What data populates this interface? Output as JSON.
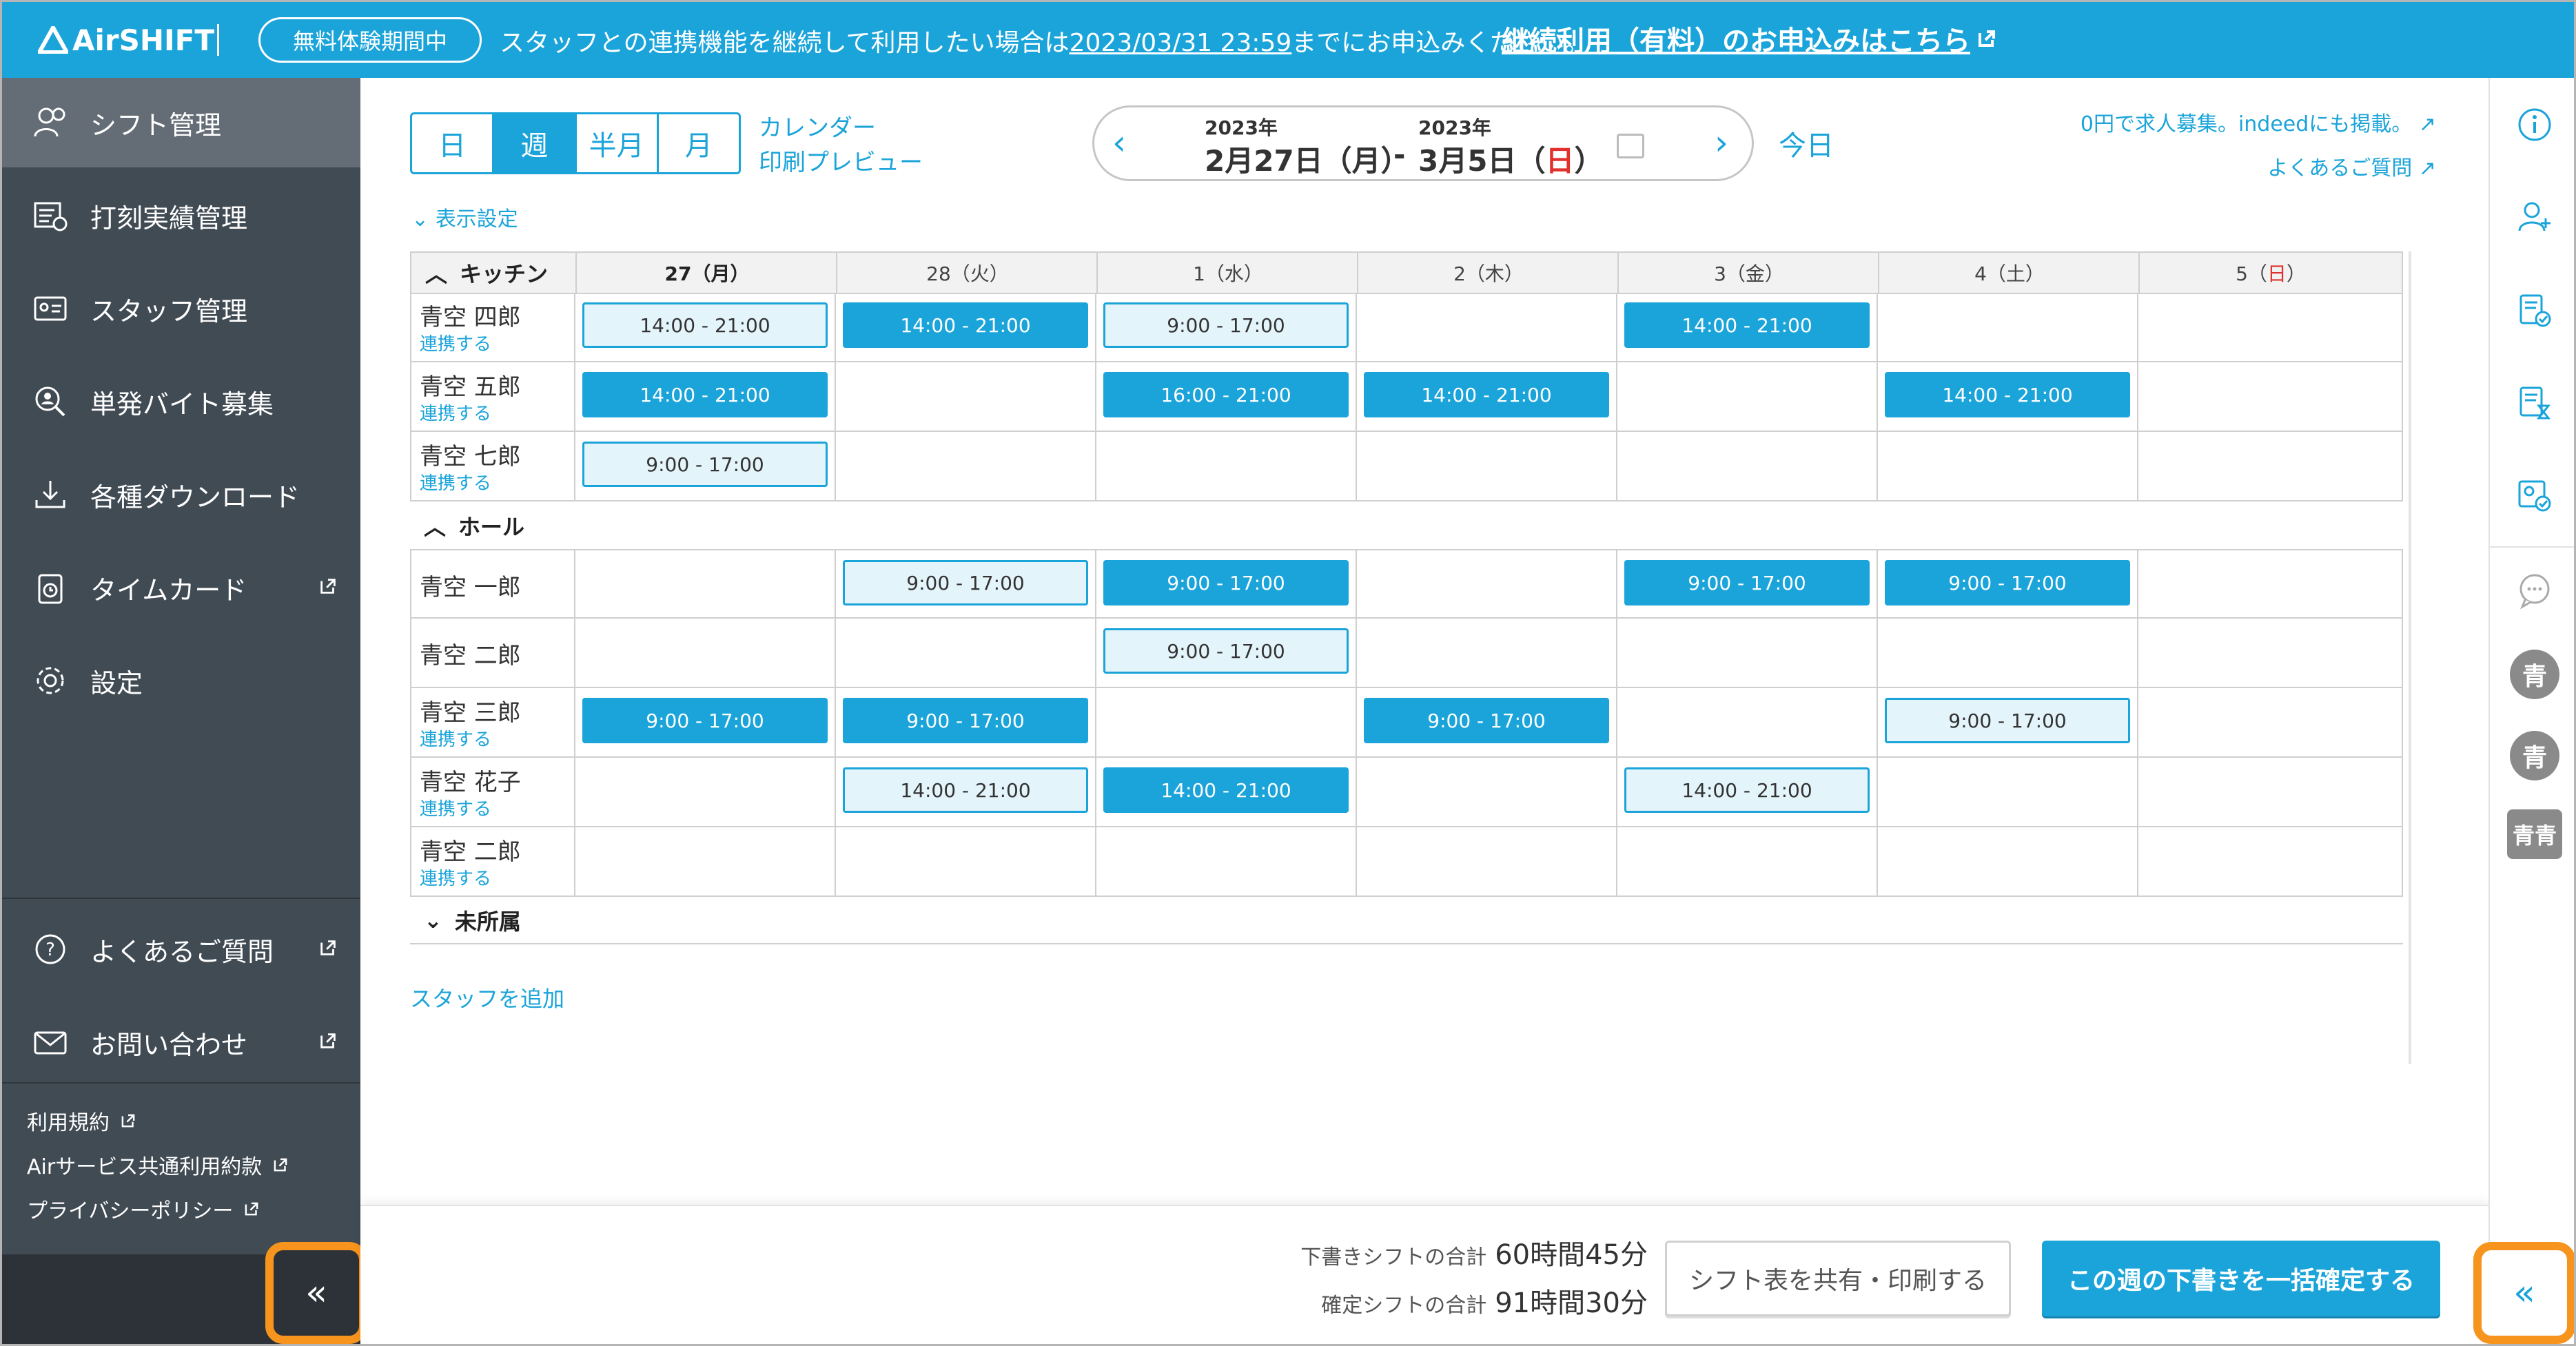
{
  "banner": {
    "logo": "AirSHIFT",
    "trial_badge": "無料体験期間中",
    "message_prefix": "スタッフとの連携機能を継続して利用したい場合は",
    "deadline": "2023/03/31 23:59",
    "message_suffix": "までにお申込みください。",
    "apply_link": "継続利用（有料）のお申込みはこちら"
  },
  "sidebar": {
    "items": [
      {
        "label": "シフト管理",
        "icon": "shift-icon"
      },
      {
        "label": "打刻実績管理",
        "icon": "timeclock-icon"
      },
      {
        "label": "スタッフ管理",
        "icon": "staff-card-icon"
      },
      {
        "label": "単発バイト募集",
        "icon": "search-person-icon"
      },
      {
        "label": "各種ダウンロード",
        "icon": "download-icon"
      },
      {
        "label": "タイムカード",
        "icon": "timecard-icon"
      },
      {
        "label": "設定",
        "icon": "gear-icon"
      }
    ],
    "help": "よくあるご質問",
    "contact": "お問い合わせ",
    "footer_links": [
      "利用規約",
      "Airサービス共通利用約款",
      "プライバシーポリシー"
    ],
    "collapse_label": "«"
  },
  "toolbar": {
    "view_tabs": [
      "日",
      "週",
      "半月",
      "月"
    ],
    "active_tab": "週",
    "calendar_print_line1": "カレンダー",
    "calendar_print_line2": "印刷プレビュー",
    "start_year": "2023年",
    "start_date": "2月27日（月）",
    "range_sep": "-",
    "end_year": "2023年",
    "end_date_prefix": "3月5日（",
    "end_date_day": "日",
    "end_date_suffix": "）",
    "today": "今日",
    "job_link": "0円で求人募集。indeedにも掲載。",
    "faq_link": "よくあるご質問",
    "display_settings": "表示設定"
  },
  "grid": {
    "days": [
      "27（月）",
      "28（火）",
      "1（水）",
      "2（木）",
      "3（金）",
      "4（土）"
    ],
    "sunday": {
      "num": "5（",
      "day": "日",
      "close": "）"
    },
    "groups": [
      {
        "title": "キッチン",
        "rows": [
          {
            "name": "青空 四郎",
            "link": "連携する",
            "shifts": [
              {
                "day": 0,
                "time": "14:00 - 21:00",
                "status": "draft"
              },
              {
                "day": 1,
                "time": "14:00 - 21:00",
                "status": "confirmed"
              },
              {
                "day": 2,
                "time": "9:00 - 17:00",
                "status": "draft"
              },
              {
                "day": 4,
                "time": "14:00 - 21:00",
                "status": "confirmed"
              }
            ]
          },
          {
            "name": "青空 五郎",
            "link": "連携する",
            "shifts": [
              {
                "day": 0,
                "time": "14:00 - 21:00",
                "status": "confirmed"
              },
              {
                "day": 2,
                "time": "16:00 - 21:00",
                "status": "confirmed"
              },
              {
                "day": 3,
                "time": "14:00 - 21:00",
                "status": "confirmed"
              },
              {
                "day": 5,
                "time": "14:00 - 21:00",
                "status": "confirmed"
              }
            ]
          },
          {
            "name": "青空 七郎",
            "link": "連携する",
            "shifts": [
              {
                "day": 0,
                "time": "9:00 - 17:00",
                "status": "draft"
              }
            ]
          }
        ]
      },
      {
        "title": "ホール",
        "rows": [
          {
            "name": "青空 一郎",
            "link": "",
            "shifts": [
              {
                "day": 1,
                "time": "9:00 - 17:00",
                "status": "draft"
              },
              {
                "day": 2,
                "time": "9:00 - 17:00",
                "status": "confirmed"
              },
              {
                "day": 4,
                "time": "9:00 - 17:00",
                "status": "confirmed"
              },
              {
                "day": 5,
                "time": "9:00 - 17:00",
                "status": "confirmed"
              }
            ]
          },
          {
            "name": "青空 二郎",
            "link": "",
            "shifts": [
              {
                "day": 2,
                "time": "9:00 - 17:00",
                "status": "draft"
              }
            ]
          },
          {
            "name": "青空 三郎",
            "link": "連携する",
            "shifts": [
              {
                "day": 0,
                "time": "9:00 - 17:00",
                "status": "confirmed"
              },
              {
                "day": 1,
                "time": "9:00 - 17:00",
                "status": "confirmed"
              },
              {
                "day": 3,
                "time": "9:00 - 17:00",
                "status": "confirmed"
              },
              {
                "day": 5,
                "time": "9:00 - 17:00",
                "status": "draft"
              }
            ]
          },
          {
            "name": "青空 花子",
            "link": "連携する",
            "shifts": [
              {
                "day": 1,
                "time": "14:00 - 21:00",
                "status": "draft"
              },
              {
                "day": 2,
                "time": "14:00 - 21:00",
                "status": "confirmed"
              },
              {
                "day": 4,
                "time": "14:00 - 21:00",
                "status": "draft"
              }
            ]
          },
          {
            "name": "青空 二郎",
            "link": "連携する",
            "shifts": []
          }
        ]
      }
    ],
    "unassigned": "未所属",
    "add_staff": "スタッフを追加"
  },
  "footer": {
    "draft_label": "下書きシフトの合計",
    "draft_value": "60時間45分",
    "confirmed_label": "確定シフトの合計",
    "confirmed_value": "91時間30分",
    "share_button": "シフト表を共有・印刷する",
    "confirm_button": "この週の下書きを一括確定する"
  },
  "right_rail": {
    "icons": [
      "info-icon",
      "add-user-icon",
      "checklist-icon",
      "document-clock-icon",
      "staff-check-icon",
      "chat-icon"
    ],
    "avatars": [
      "青",
      "青",
      "青青"
    ],
    "collapse_label": "«"
  },
  "colors": {
    "brand": "#1ba4da",
    "sidebar": "#414b54",
    "highlight": "#f7941d",
    "sunday": "#e0312d"
  }
}
